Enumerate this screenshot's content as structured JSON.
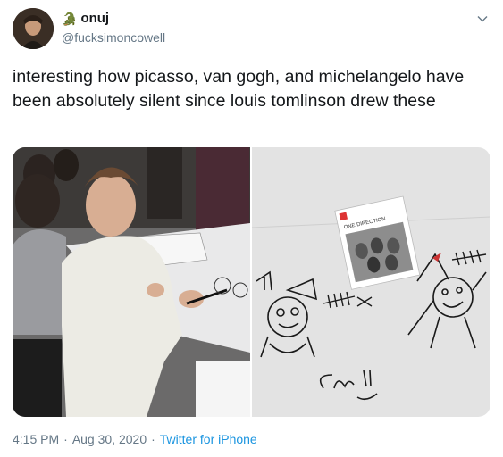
{
  "user": {
    "display_name": "onuj",
    "name_emoji": "🐊",
    "handle": "@fucksimoncowell"
  },
  "tweet": {
    "text": "interesting how picasso, van gogh, and michelangelo have been absolutely silent since louis tomlinson drew these"
  },
  "media": {
    "photo_left": {
      "description_icon": "signing-photo"
    },
    "photo_right": {
      "album_title": "ONE DIRECTION",
      "signature_text": "Lou :)"
    }
  },
  "meta": {
    "time": "4:15 PM",
    "separator1": "·",
    "date": "Aug 30, 2020",
    "separator2": "·",
    "source": "Twitter for iPhone"
  },
  "colors": {
    "text": "#14171a",
    "secondary": "#657786",
    "link": "#1b95e0"
  }
}
